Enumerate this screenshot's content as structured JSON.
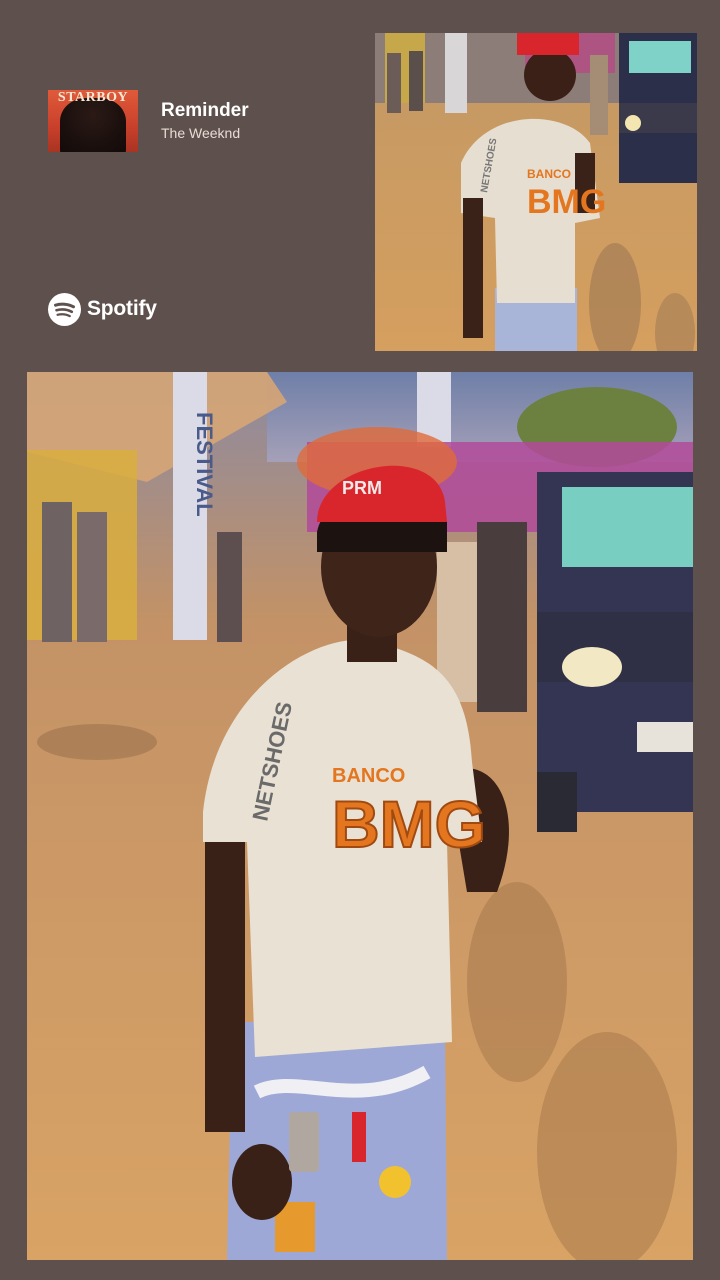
{
  "now_playing": {
    "album_art_text": "STARBOY",
    "track_title": "Reminder",
    "artist": "The Weeknd"
  },
  "branding": {
    "logo_icon": "spotify-icon",
    "wordmark": "Spotify"
  },
  "photos": {
    "small": {
      "jersey_logo": "BMG",
      "jersey_text": "BANCO",
      "sleeve_text": "NETSHOES"
    },
    "large": {
      "jersey_logo": "BMG",
      "jersey_text": "BANCO",
      "sleeve_text": "NETSHOES",
      "sign_text": "FESTIVAL",
      "cap_text": "PRM"
    }
  },
  "colors": {
    "background": "#5e504c",
    "text_primary": "#ffffff",
    "jersey": "#e9e1d3",
    "jersey_accent": "#e3761f",
    "cap": "#d8262c",
    "ground": "#d39c5d"
  }
}
